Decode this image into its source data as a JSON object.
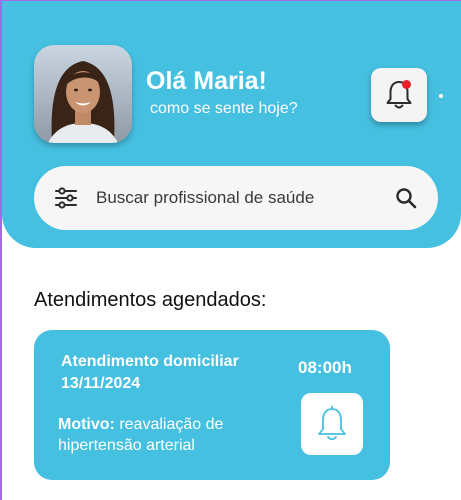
{
  "header": {
    "greeting": "Olá Maria!",
    "subtitle": "como se sente hoje?",
    "bg_color": "#45c0e1",
    "avatar": "user-avatar-photo",
    "notification": {
      "icon": "bell-icon",
      "has_unread": true,
      "dot_color": "#e8202a"
    }
  },
  "search": {
    "placeholder": "Buscar profissional de saúde",
    "left_icon": "filter-sliders-icon",
    "right_icon": "search-icon"
  },
  "appointments": {
    "title": "Atendimentos agendados:",
    "items": [
      {
        "type": "Atendimento domiciliar",
        "date": "13/11/2024",
        "time": "08:00h",
        "reason_label": "Motivo:",
        "reason": " reavaliação de hipertensão arterial",
        "icon": "bell-icon"
      }
    ]
  }
}
